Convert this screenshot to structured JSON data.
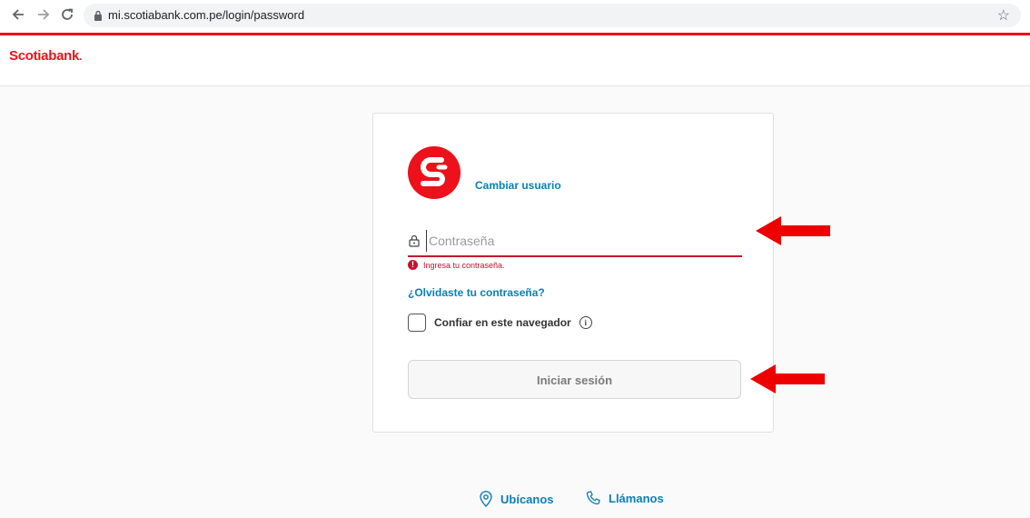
{
  "browser": {
    "url": "mi.scotiabank.com.pe/login/password"
  },
  "header": {
    "brand": "Scotiabank",
    "brand_suffix": "."
  },
  "login": {
    "change_user_label": "Cambiar usuario",
    "password_placeholder": "Contraseña",
    "password_value": "",
    "error_message": "Ingresa tu contraseña.",
    "forgot_label": "¿Olvidaste tu contraseña?",
    "trust_label": "Confiar en este navegador",
    "trust_checked": false,
    "submit_label": "Iniciar sesión"
  },
  "footer": {
    "locate_label": "Ubícanos",
    "call_label": "Llámanos"
  },
  "colors": {
    "brand_red": "#ec111a",
    "link_blue": "#0a7fb5",
    "error_red": "#c8102e"
  }
}
